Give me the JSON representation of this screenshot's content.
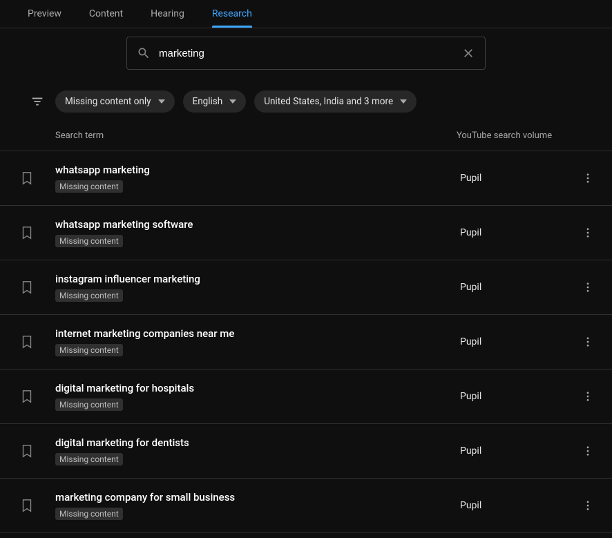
{
  "tabs": [
    {
      "label": "Preview",
      "active": false
    },
    {
      "label": "Content",
      "active": false
    },
    {
      "label": "Hearing",
      "active": false
    },
    {
      "label": "Research",
      "active": true
    }
  ],
  "search": {
    "value": "marketing"
  },
  "filters": {
    "chips": [
      {
        "label": "Missing content only"
      },
      {
        "label": "English"
      },
      {
        "label": "United States, India and 3 more"
      }
    ]
  },
  "columns": {
    "term": "Search term",
    "volume": "YouTube search volume"
  },
  "rows": [
    {
      "term": "whatsapp marketing",
      "tag": "Missing content",
      "volume": "Pupil"
    },
    {
      "term": "whatsapp marketing software",
      "tag": "Missing content",
      "volume": "Pupil"
    },
    {
      "term": "instagram influencer marketing",
      "tag": "Missing content",
      "volume": "Pupil"
    },
    {
      "term": "internet marketing companies near me",
      "tag": "Missing content",
      "volume": "Pupil"
    },
    {
      "term": "digital marketing for hospitals",
      "tag": "Missing content",
      "volume": "Pupil"
    },
    {
      "term": "digital marketing for dentists",
      "tag": "Missing content",
      "volume": "Pupil"
    },
    {
      "term": "marketing company for small business",
      "tag": "Missing content",
      "volume": "Pupil"
    }
  ]
}
